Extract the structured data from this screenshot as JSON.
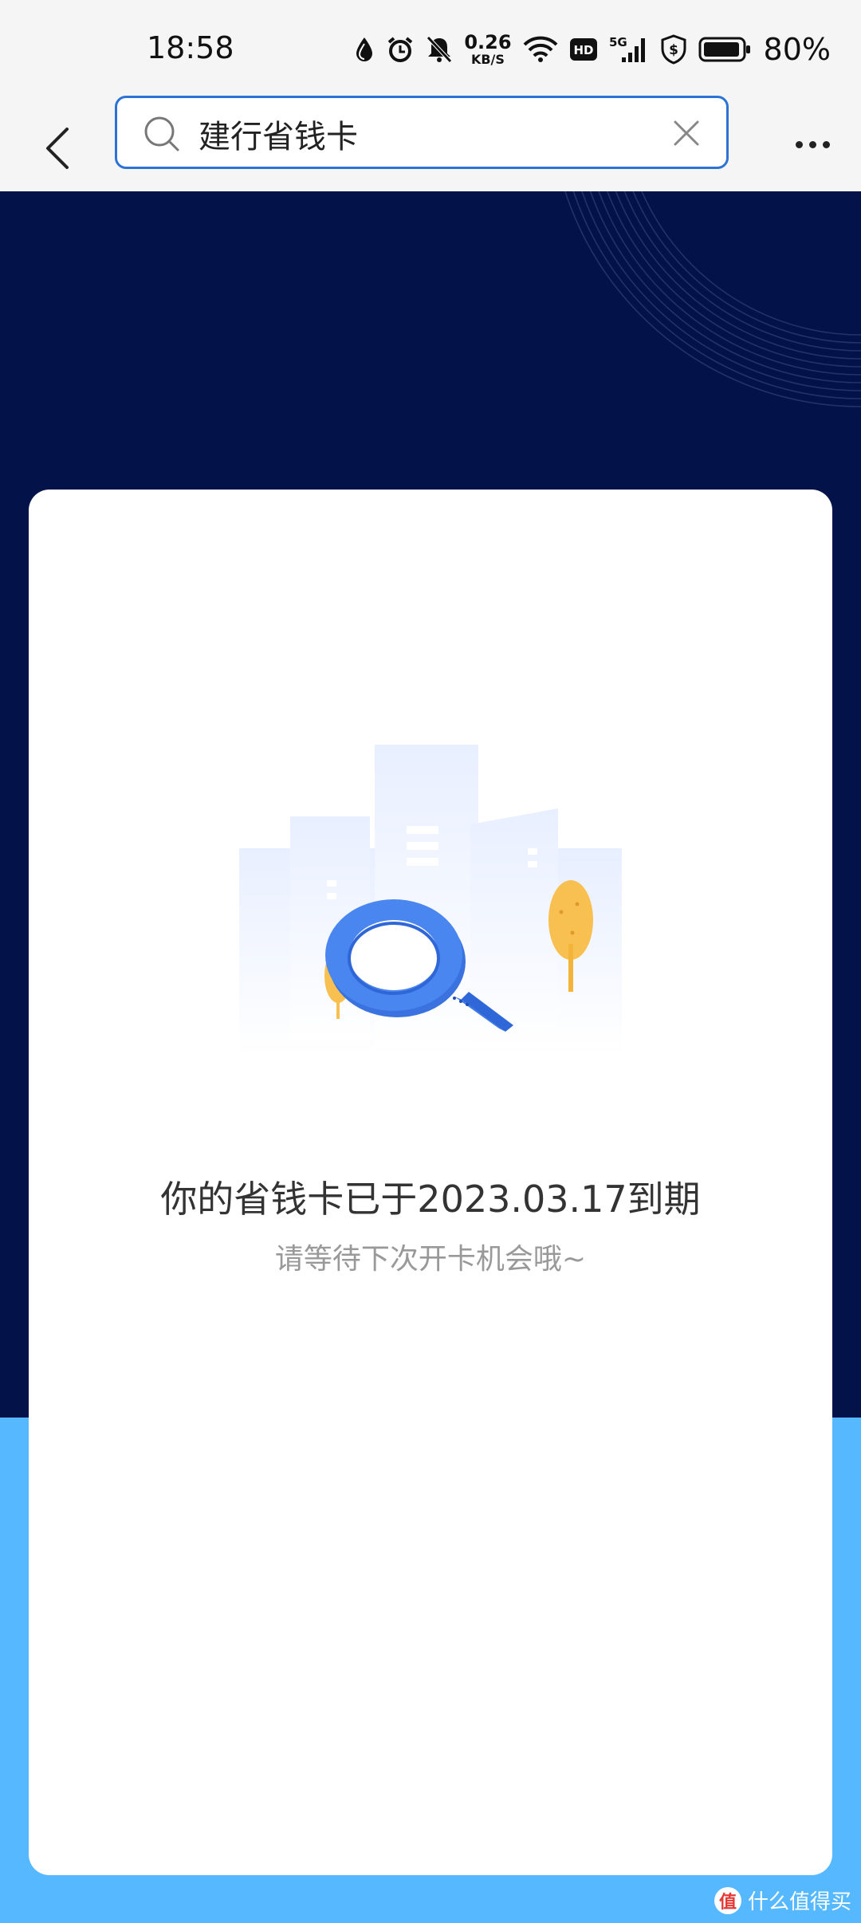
{
  "status_bar": {
    "time": "18:58",
    "net_speed_value": "0.26",
    "net_speed_unit": "KB/S",
    "network_label": "5G",
    "hd_label": "HD",
    "battery_percent": "80%",
    "icons": [
      "drop-icon",
      "alarm-icon",
      "bell-off-icon",
      "wifi-icon",
      "hd-icon",
      "signal-5g-icon",
      "shield-dollar-icon",
      "battery-icon"
    ]
  },
  "search": {
    "query": "建行省钱卡"
  },
  "card": {
    "expire_message": "你的省钱卡已于2023.03.17到期",
    "hint_message": "请等待下次开卡机会哦~"
  },
  "watermark": {
    "logo_text": "值",
    "text": "什么值得买"
  },
  "colors": {
    "banner_bg": "#03134a",
    "page_bg": "#56b8ff",
    "search_border": "#2d73d6",
    "magnifier_blue": "#4a86f0",
    "tree_yellow": "#f7c050"
  }
}
